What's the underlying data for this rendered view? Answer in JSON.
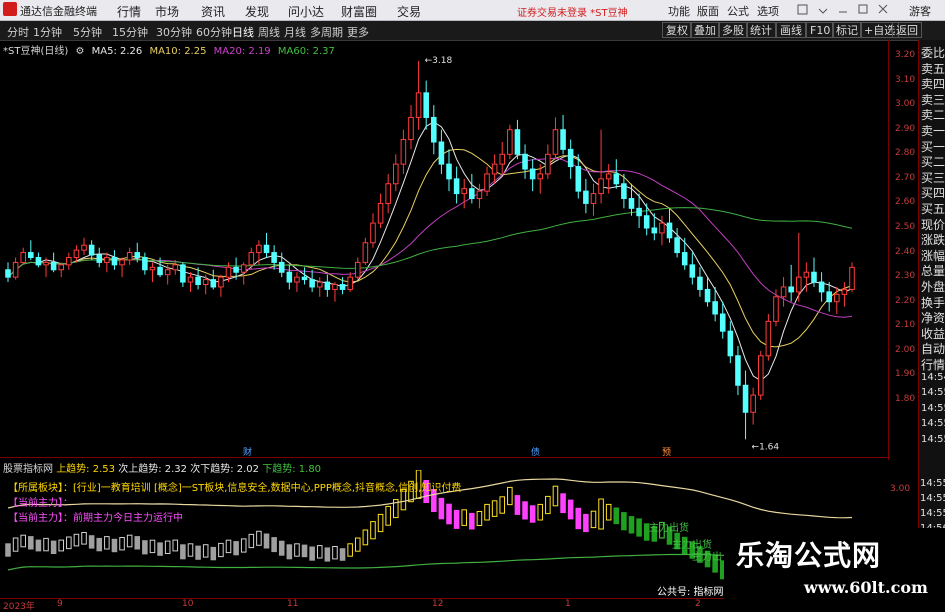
{
  "topbar": {
    "app_name": "通达信金融终端",
    "menu": [
      "行情",
      "市场",
      "资讯",
      "发现",
      "问小达",
      "财富圈",
      "交易"
    ],
    "alert": "证券交易未登录 *ST豆神",
    "right_menu": [
      "功能",
      "版面",
      "公式",
      "选项",
      "游客"
    ]
  },
  "periods": [
    "分时",
    "1分钟",
    "5分钟",
    "15分钟",
    "30分钟",
    "60分钟",
    "日线",
    "周线",
    "月线",
    "多周期",
    "更多"
  ],
  "active_period": "日线",
  "toolbar_buttons": [
    "复权",
    "叠加",
    "多股",
    "统计",
    "画线",
    "F10",
    "标记",
    "+自选",
    "返回"
  ],
  "title_line": {
    "stock": "*ST豆神(日线)",
    "ma5": "MA5: 2.26",
    "ma10": "MA10: 2.25",
    "ma20": "MA20: 2.19",
    "ma60": "MA60: 2.37"
  },
  "right_labels": [
    "委比",
    "卖五",
    "卖四",
    "卖三",
    "卖二",
    "卖一",
    "买一",
    "买二",
    "买三",
    "买四",
    "买五",
    "现价",
    "涨跌",
    "涨幅",
    "总量",
    "外盘",
    "换手",
    "净资",
    "收益",
    "自动",
    "行情",
    "14:54",
    "14:55",
    "14:55",
    "14:55",
    "14:55"
  ],
  "lower_right_labels": [
    "14:55",
    "14:55",
    "14:55",
    "14:56",
    "14:56",
    "14:56"
  ],
  "lower_header": {
    "name": "股票指标网",
    "up_trend": "上趋势: 2.53",
    "next_up": "次上趋势: 2.32",
    "next_down": "次下趋势: 2.02",
    "down_trend": "下趋势: 1.80"
  },
  "indicator_lines": [
    "【所属板块】：[行业]一教育培训 [概念]一ST板块,信息安全,数据中心,PPP概念,抖音概念,信创,知识付费",
    "【当前主力】：",
    "【当前主力】：前期主力今日主力运行中"
  ],
  "annotations": {
    "high": "3.18",
    "low": "1.64",
    "lower_a": "主力出货",
    "lower_b": "主力出货",
    "lower_c": "主力出",
    "lower_d": "公共号: 指标网"
  },
  "event_markers": [
    "财",
    "债",
    "预"
  ],
  "watermark": {
    "title": "乐淘公式网",
    "url": "www.60lt.com"
  },
  "x_axis": [
    "2023年",
    "9",
    "10",
    "11",
    "12",
    "1",
    "2"
  ],
  "chart_data": {
    "type": "candlestick",
    "y_ticks": [
      3.2,
      3.1,
      3.0,
      2.9,
      2.8,
      2.7,
      2.6,
      2.5,
      2.4,
      2.3,
      2.2,
      2.1,
      2.0,
      1.9,
      1.8
    ],
    "ylim": [
      1.64,
      3.22
    ],
    "lower_y_tick": "3.00",
    "candles": [
      [
        2.33,
        2.36,
        2.28,
        2.3
      ],
      [
        2.3,
        2.38,
        2.29,
        2.36
      ],
      [
        2.36,
        2.42,
        2.35,
        2.4
      ],
      [
        2.4,
        2.45,
        2.37,
        2.38
      ],
      [
        2.38,
        2.4,
        2.34,
        2.35
      ],
      [
        2.35,
        2.38,
        2.3,
        2.36
      ],
      [
        2.36,
        2.4,
        2.32,
        2.33
      ],
      [
        2.33,
        2.36,
        2.3,
        2.35
      ],
      [
        2.35,
        2.4,
        2.33,
        2.38
      ],
      [
        2.38,
        2.43,
        2.36,
        2.41
      ],
      [
        2.41,
        2.46,
        2.39,
        2.43
      ],
      [
        2.43,
        2.45,
        2.37,
        2.39
      ],
      [
        2.39,
        2.42,
        2.34,
        2.36
      ],
      [
        2.36,
        2.4,
        2.32,
        2.38
      ],
      [
        2.38,
        2.41,
        2.33,
        2.35
      ],
      [
        2.35,
        2.38,
        2.3,
        2.37
      ],
      [
        2.37,
        2.42,
        2.35,
        2.4
      ],
      [
        2.4,
        2.44,
        2.36,
        2.38
      ],
      [
        2.38,
        2.4,
        2.31,
        2.33
      ],
      [
        2.33,
        2.36,
        2.28,
        2.34
      ],
      [
        2.34,
        2.38,
        2.3,
        2.31
      ],
      [
        2.31,
        2.35,
        2.27,
        2.33
      ],
      [
        2.33,
        2.37,
        2.31,
        2.35
      ],
      [
        2.35,
        2.36,
        2.26,
        2.28
      ],
      [
        2.28,
        2.32,
        2.24,
        2.3
      ],
      [
        2.3,
        2.34,
        2.25,
        2.27
      ],
      [
        2.27,
        2.31,
        2.23,
        2.29
      ],
      [
        2.29,
        2.33,
        2.25,
        2.26
      ],
      [
        2.26,
        2.31,
        2.22,
        2.3
      ],
      [
        2.3,
        2.36,
        2.28,
        2.34
      ],
      [
        2.34,
        2.38,
        2.29,
        2.32
      ],
      [
        2.32,
        2.36,
        2.27,
        2.35
      ],
      [
        2.35,
        2.42,
        2.33,
        2.4
      ],
      [
        2.4,
        2.45,
        2.35,
        2.43
      ],
      [
        2.43,
        2.48,
        2.38,
        2.4
      ],
      [
        2.4,
        2.43,
        2.33,
        2.36
      ],
      [
        2.36,
        2.4,
        2.3,
        2.32
      ],
      [
        2.32,
        2.35,
        2.25,
        2.28
      ],
      [
        2.28,
        2.32,
        2.24,
        2.3
      ],
      [
        2.3,
        2.34,
        2.27,
        2.29
      ],
      [
        2.29,
        2.33,
        2.24,
        2.26
      ],
      [
        2.26,
        2.3,
        2.22,
        2.28
      ],
      [
        2.28,
        2.31,
        2.22,
        2.25
      ],
      [
        2.25,
        2.28,
        2.2,
        2.27
      ],
      [
        2.27,
        2.3,
        2.23,
        2.25
      ],
      [
        2.25,
        2.32,
        2.24,
        2.3
      ],
      [
        2.3,
        2.38,
        2.29,
        2.36
      ],
      [
        2.36,
        2.46,
        2.35,
        2.44
      ],
      [
        2.44,
        2.56,
        2.42,
        2.52
      ],
      [
        2.52,
        2.64,
        2.5,
        2.6
      ],
      [
        2.6,
        2.72,
        2.56,
        2.68
      ],
      [
        2.68,
        2.8,
        2.65,
        2.76
      ],
      [
        2.76,
        2.9,
        2.72,
        2.86
      ],
      [
        2.86,
        3.0,
        2.82,
        2.95
      ],
      [
        2.95,
        3.18,
        2.9,
        3.05
      ],
      [
        3.05,
        3.1,
        2.9,
        2.95
      ],
      [
        2.95,
        3.0,
        2.8,
        2.85
      ],
      [
        2.85,
        2.9,
        2.72,
        2.76
      ],
      [
        2.76,
        2.82,
        2.65,
        2.7
      ],
      [
        2.7,
        2.75,
        2.6,
        2.64
      ],
      [
        2.64,
        2.7,
        2.58,
        2.66
      ],
      [
        2.66,
        2.72,
        2.6,
        2.62
      ],
      [
        2.62,
        2.68,
        2.58,
        2.65
      ],
      [
        2.65,
        2.75,
        2.63,
        2.72
      ],
      [
        2.72,
        2.8,
        2.68,
        2.76
      ],
      [
        2.76,
        2.85,
        2.72,
        2.8
      ],
      [
        2.8,
        2.92,
        2.78,
        2.9
      ],
      [
        2.9,
        2.94,
        2.78,
        2.8
      ],
      [
        2.8,
        2.84,
        2.7,
        2.74
      ],
      [
        2.74,
        2.78,
        2.65,
        2.7
      ],
      [
        2.7,
        2.76,
        2.64,
        2.72
      ],
      [
        2.72,
        2.84,
        2.7,
        2.8
      ],
      [
        2.8,
        2.95,
        2.78,
        2.9
      ],
      [
        2.9,
        2.96,
        2.8,
        2.82
      ],
      [
        2.82,
        2.86,
        2.7,
        2.75
      ],
      [
        2.75,
        2.8,
        2.62,
        2.65
      ],
      [
        2.65,
        2.7,
        2.56,
        2.6
      ],
      [
        2.6,
        2.68,
        2.55,
        2.64
      ],
      [
        2.64,
        2.9,
        2.6,
        2.7
      ],
      [
        2.7,
        2.76,
        2.64,
        2.72
      ],
      [
        2.72,
        2.78,
        2.66,
        2.68
      ],
      [
        2.68,
        2.72,
        2.58,
        2.62
      ],
      [
        2.62,
        2.68,
        2.55,
        2.58
      ],
      [
        2.58,
        2.64,
        2.5,
        2.55
      ],
      [
        2.55,
        2.6,
        2.47,
        2.5
      ],
      [
        2.5,
        2.56,
        2.45,
        2.48
      ],
      [
        2.48,
        2.55,
        2.43,
        2.52
      ],
      [
        2.52,
        2.58,
        2.44,
        2.46
      ],
      [
        2.46,
        2.5,
        2.38,
        2.4
      ],
      [
        2.4,
        2.46,
        2.33,
        2.35
      ],
      [
        2.35,
        2.4,
        2.27,
        2.3
      ],
      [
        2.3,
        2.34,
        2.22,
        2.25
      ],
      [
        2.25,
        2.3,
        2.18,
        2.2
      ],
      [
        2.2,
        2.26,
        2.12,
        2.15
      ],
      [
        2.15,
        2.2,
        2.05,
        2.08
      ],
      [
        2.08,
        2.12,
        1.95,
        1.98
      ],
      [
        1.98,
        2.02,
        1.82,
        1.86
      ],
      [
        1.86,
        1.92,
        1.64,
        1.75
      ],
      [
        1.75,
        1.85,
        1.7,
        1.82
      ],
      [
        1.82,
        2.0,
        1.8,
        1.98
      ],
      [
        1.98,
        2.15,
        1.96,
        2.12
      ],
      [
        2.12,
        2.25,
        2.1,
        2.22
      ],
      [
        2.22,
        2.3,
        2.18,
        2.26
      ],
      [
        2.26,
        2.35,
        2.2,
        2.24
      ],
      [
        2.24,
        2.48,
        2.2,
        2.3
      ],
      [
        2.3,
        2.36,
        2.24,
        2.32
      ],
      [
        2.32,
        2.38,
        2.26,
        2.28
      ],
      [
        2.28,
        2.32,
        2.2,
        2.24
      ],
      [
        2.24,
        2.28,
        2.16,
        2.2
      ],
      [
        2.2,
        2.26,
        2.15,
        2.23
      ],
      [
        2.23,
        2.28,
        2.18,
        2.25
      ],
      [
        2.25,
        2.36,
        2.24,
        2.34
      ]
    ]
  }
}
